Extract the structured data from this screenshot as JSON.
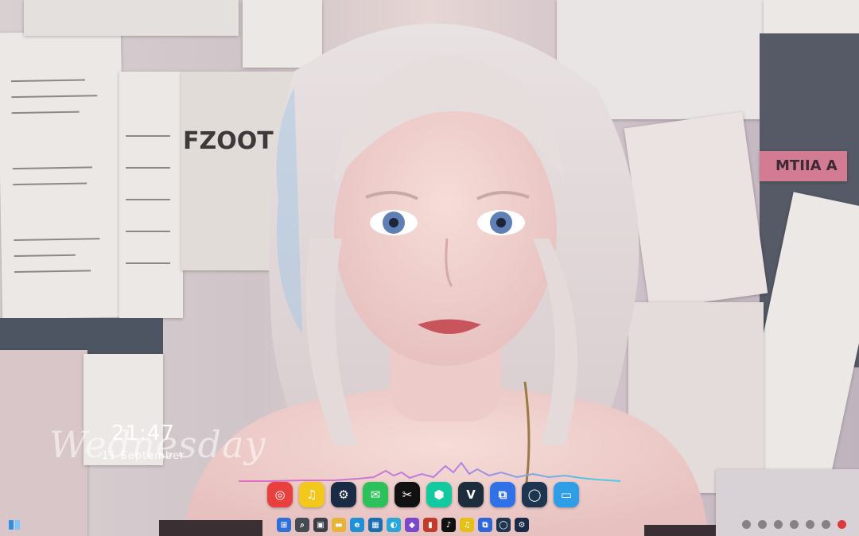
{
  "desktop": {
    "poster_texts": [
      "FZOOT",
      "MTIIA A"
    ]
  },
  "clock": {
    "decorative_day": "Wednesday",
    "time": "21:47",
    "date": "11 September"
  },
  "dock": {
    "apps": [
      {
        "name": "netease-music-icon",
        "color": "#e8403f",
        "glyph": "◎"
      },
      {
        "name": "qq-music-icon",
        "color": "#f2c81d",
        "glyph": "♫"
      },
      {
        "name": "steam-icon",
        "color": "#1b2a45",
        "glyph": "⚙"
      },
      {
        "name": "wechat-icon",
        "color": "#2dc15b",
        "glyph": "✉"
      },
      {
        "name": "capcut-icon",
        "color": "#111111",
        "glyph": "✂"
      },
      {
        "name": "mint-app-icon",
        "color": "#13c9a0",
        "glyph": "⬢"
      },
      {
        "name": "v-app-icon",
        "color": "#1e2d3b",
        "glyph": "V"
      },
      {
        "name": "remote-desktop-icon",
        "color": "#3171e8",
        "glyph": "⧉"
      },
      {
        "name": "ring-app-icon",
        "color": "#1e3550",
        "glyph": "◯"
      },
      {
        "name": "monitor-icon",
        "color": "#2f9ee6",
        "glyph": "▭"
      }
    ]
  },
  "taskbar": {
    "icons": [
      {
        "name": "start-icon",
        "color": "#2f6fd6",
        "glyph": "⊞"
      },
      {
        "name": "search-icon",
        "color": "#444b55",
        "glyph": "⌕"
      },
      {
        "name": "task-view-icon",
        "color": "#3b3f47",
        "glyph": "▣"
      },
      {
        "name": "file-explorer-icon",
        "color": "#e8b437",
        "glyph": "▬"
      },
      {
        "name": "edge-icon",
        "color": "#1f8fd6",
        "glyph": "e"
      },
      {
        "name": "store-icon",
        "color": "#1a6fb3",
        "glyph": "▦"
      },
      {
        "name": "browser-icon",
        "color": "#2aa7d9",
        "glyph": "◐"
      },
      {
        "name": "visual-app-icon",
        "color": "#7a48c9",
        "glyph": "◆"
      },
      {
        "name": "media-app-icon",
        "color": "#c23b2a",
        "glyph": "▮"
      },
      {
        "name": "tiktok-icon",
        "color": "#111111",
        "glyph": "♪"
      },
      {
        "name": "qq-music-icon",
        "color": "#e5c019",
        "glyph": "♫"
      },
      {
        "name": "remote-desktop-icon",
        "color": "#2f66d8",
        "glyph": "⧉"
      },
      {
        "name": "ring-app-icon",
        "color": "#1f3550",
        "glyph": "◯"
      },
      {
        "name": "steam-icon",
        "color": "#1b2a45",
        "glyph": "⚙"
      }
    ]
  }
}
